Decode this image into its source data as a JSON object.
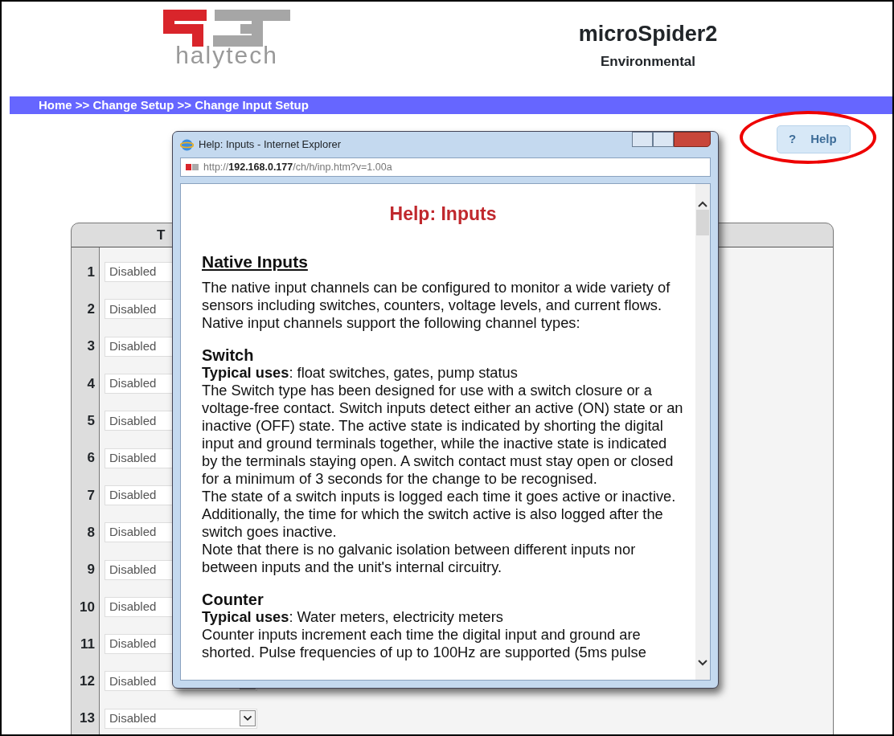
{
  "header": {
    "logo_text": "halytech",
    "product": "microSpider2",
    "subtitle": "Environmental"
  },
  "breadcrumb": "Home >> Change Setup >> Change Input Setup",
  "help_button": {
    "icon": "?",
    "label": "Help"
  },
  "input_panel": {
    "column_1": "T",
    "rows": [
      {
        "number": "1",
        "value": "Disabled"
      },
      {
        "number": "2",
        "value": "Disabled"
      },
      {
        "number": "3",
        "value": "Disabled"
      },
      {
        "number": "4",
        "value": "Disabled"
      },
      {
        "number": "5",
        "value": "Disabled"
      },
      {
        "number": "6",
        "value": "Disabled"
      },
      {
        "number": "7",
        "value": "Disabled"
      },
      {
        "number": "8",
        "value": "Disabled"
      },
      {
        "number": "9",
        "value": "Disabled"
      },
      {
        "number": "10",
        "value": "Disabled"
      },
      {
        "number": "11",
        "value": "Disabled"
      },
      {
        "number": "12",
        "value": "Disabled"
      },
      {
        "number": "13",
        "value": "Disabled"
      }
    ]
  },
  "popup": {
    "title": "Help: Inputs - Internet Explorer",
    "url": "http://**192.168.0.177**/ch/h/inp.htm?v=1.00a",
    "heading": "Help: Inputs",
    "blocks": [
      {
        "kind": "section",
        "text": "Native Inputs"
      },
      {
        "kind": "para",
        "text": "The native input channels can be configured to monitor a wide variety of sensors including switches, counters, voltage levels, and current flows. Native input channels support the following channel types:"
      },
      {
        "kind": "subsection",
        "text": "Switch"
      },
      {
        "kind": "line",
        "text": "**Typical uses**: float switches, gates, pump status"
      },
      {
        "kind": "line",
        "text": "The Switch type has been designed for use with a switch closure or a voltage-free contact. Switch inputs detect either an active (ON) state or an inactive (OFF) state. The active state is indicated by shorting the digital input and ground terminals together, while the inactive state is indicated by the terminals staying open. A switch contact must stay open or closed for a minimum of 3 seconds for the change to be recognised."
      },
      {
        "kind": "line",
        "text": "The state of a switch inputs is logged each time it goes active or inactive. Additionally, the time for which the switch active is also logged after the switch goes inactive."
      },
      {
        "kind": "line",
        "text": "Note that there is no galvanic isolation between different inputs nor between inputs and the unit's internal circuitry."
      },
      {
        "kind": "subsection",
        "text": "Counter"
      },
      {
        "kind": "line",
        "text": "**Typical uses**: Water meters, electricity meters"
      },
      {
        "kind": "line",
        "text": "Counter inputs increment each time the digital input and ground are shorted. Pulse frequencies of up to 100Hz are supported (5ms pulse"
      }
    ]
  }
}
